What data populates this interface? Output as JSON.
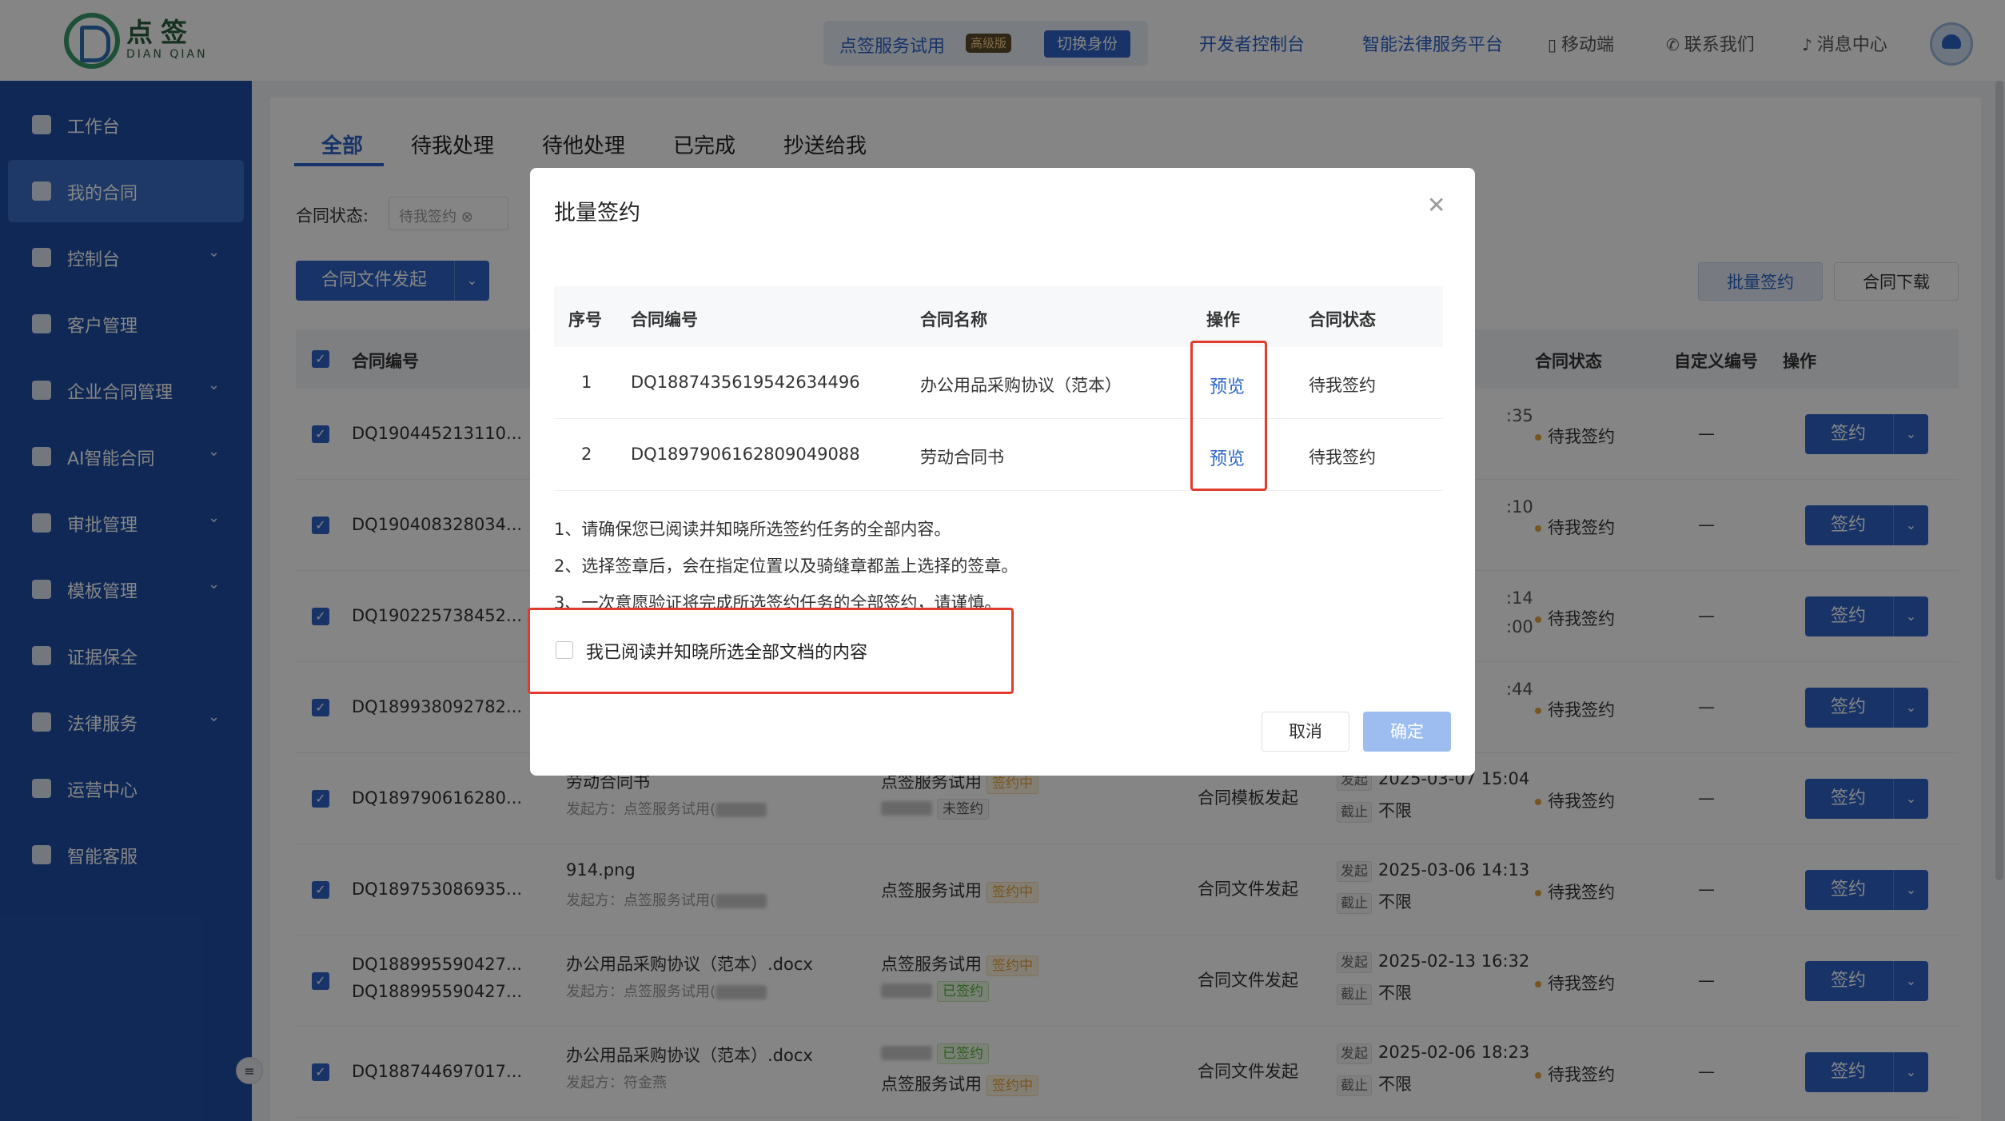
{
  "header": {
    "logo_cn": "点签",
    "logo_en": "DIAN QIAN",
    "account_name": "点签服务试用",
    "plan_badge": "高级版",
    "switch_identity": "切换身份",
    "dev_console": "开发者控制台",
    "legal_platform": "智能法律服务平台",
    "mobile": "移动端",
    "contact": "联系我们",
    "messages": "消息中心"
  },
  "sidebar": {
    "items": [
      {
        "label": "工作台",
        "icon": "home-icon",
        "expandable": false
      },
      {
        "label": "我的合同",
        "icon": "contract-icon",
        "expandable": false,
        "active": true
      },
      {
        "label": "控制台",
        "icon": "console-icon",
        "expandable": true
      },
      {
        "label": "客户管理",
        "icon": "briefcase-icon",
        "expandable": false
      },
      {
        "label": "企业合同管理",
        "icon": "document-icon",
        "expandable": true
      },
      {
        "label": "AI智能合同",
        "icon": "ai-icon",
        "expandable": true
      },
      {
        "label": "审批管理",
        "icon": "approval-icon",
        "expandable": true
      },
      {
        "label": "模板管理",
        "icon": "layers-icon",
        "expandable": true
      },
      {
        "label": "证据保全",
        "icon": "evidence-icon",
        "expandable": false
      },
      {
        "label": "法律服务",
        "icon": "legal-icon",
        "expandable": true
      },
      {
        "label": "运营中心",
        "icon": "user-icon",
        "expandable": false
      },
      {
        "label": "智能客服",
        "icon": "bot-icon",
        "expandable": false
      }
    ]
  },
  "main": {
    "tabs": [
      "全部",
      "待我处理",
      "待他处理",
      "已完成",
      "抄送给我"
    ],
    "filter_label": "合同状态:",
    "filter_tag": "待我签约",
    "launch_button": "合同文件发起",
    "batch_sign_button": "批量签约",
    "download_button": "合同下载",
    "columns": {
      "contract_no": "合同编号",
      "status": "合同状态",
      "custom_no": "自定义编号",
      "action": "操作"
    },
    "sign_label": "签约",
    "rows": [
      {
        "no": "DQ190445213110...",
        "time_frag": ":35",
        "status": "待我签约",
        "custom": "—"
      },
      {
        "no": "DQ190408328034...",
        "time_frag": ":10",
        "status": "待我签约",
        "custom": "—"
      },
      {
        "no": "DQ190225738452...",
        "time_frag": ":14",
        "time_frag2": ":00",
        "status": "待我签约",
        "custom": "—"
      },
      {
        "no": "DQ189938092782...",
        "time_frag": ":44",
        "status": "待我签约",
        "custom": "—"
      },
      {
        "no": "DQ189790616280...",
        "title": "劳动合同书",
        "initiator": "发起方：点签服务试用(",
        "party": "点签服务试用",
        "party_tag": "签约中",
        "second_tag": "未签约",
        "method": "合同模板发起",
        "start_label": "发起",
        "start_time": "2025-03-07 15:04",
        "end_label": "截止",
        "end_value": "不限",
        "status": "待我签约",
        "custom": "—"
      },
      {
        "no": "DQ189753086935...",
        "title": "914.png",
        "initiator": "发起方：点签服务试用(",
        "party": "点签服务试用",
        "party_tag": "签约中",
        "method": "合同文件发起",
        "start_label": "发起",
        "start_time": "2025-03-06 14:13",
        "end_label": "截止",
        "end_value": "不限",
        "status": "待我签约",
        "custom": "—"
      },
      {
        "no": "DQ188995590427...",
        "no2": "DQ188995590427...",
        "title": "办公用品采购协议（范本）.docx",
        "initiator": "发起方：点签服务试用(",
        "party": "点签服务试用",
        "party_tag": "签约中",
        "second_tag": "已签约",
        "method": "合同文件发起",
        "start_label": "发起",
        "start_time": "2025-02-13 16:32",
        "end_label": "截止",
        "end_value": "不限",
        "status": "待我签约",
        "custom": "—"
      },
      {
        "no": "DQ188744697017...",
        "title": "办公用品采购协议（范本）.docx",
        "initiator": "发起方：符金燕",
        "first_tag": "已签约",
        "party": "点签服务试用",
        "party_tag": "签约中",
        "method": "合同文件发起",
        "start_label": "发起",
        "start_time": "2025-02-06 18:23",
        "end_label": "截止",
        "end_value": "不限",
        "status": "待我签约",
        "custom": "—"
      }
    ]
  },
  "modal": {
    "title": "批量签约",
    "columns": [
      "序号",
      "合同编号",
      "合同名称",
      "操作",
      "合同状态"
    ],
    "rows": [
      {
        "index": "1",
        "no": "DQ1887435619542634496",
        "name": "办公用品采购协议（范本）",
        "action": "预览",
        "status": "待我签约"
      },
      {
        "index": "2",
        "no": "DQ1897906162809049088",
        "name": "劳动合同书",
        "action": "预览",
        "status": "待我签约"
      }
    ],
    "notes": [
      "1、请确保您已阅读并知晓所选签约任务的全部内容。",
      "2、选择签章后，会在指定位置以及骑缝章都盖上选择的签章。",
      "3、一次意愿验证将完成所选签约任务的全部签约，请谨慎。"
    ],
    "confirm_read": "我已阅读并知晓所选全部文档的内容",
    "cancel": "取消",
    "ok": "确定"
  },
  "colors": {
    "brand_blue": "#2d63c8",
    "sidebar": "#1e4ea6",
    "highlight_red": "#e23b2e",
    "warning_orange": "#e6a23c",
    "success_green": "#5ab33c"
  }
}
